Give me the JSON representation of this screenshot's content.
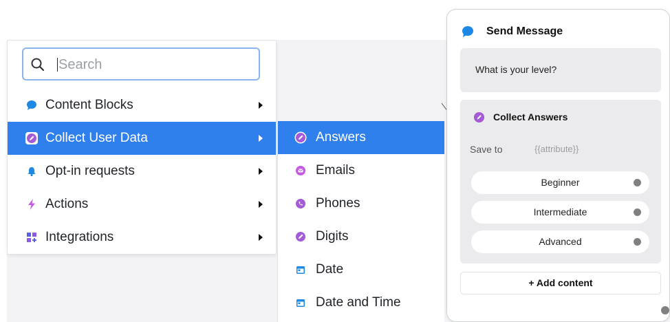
{
  "search": {
    "placeholder": "Search"
  },
  "menu": {
    "items": [
      {
        "label": "Content Blocks",
        "icon": "chat-bubble-icon"
      },
      {
        "label": "Collect User Data",
        "icon": "edit-circle-icon",
        "active": true
      },
      {
        "label": "Opt-in requests",
        "icon": "bell-icon"
      },
      {
        "label": "Actions",
        "icon": "lightning-icon"
      },
      {
        "label": "Integrations",
        "icon": "grid-plus-icon"
      }
    ]
  },
  "submenu": {
    "items": [
      {
        "label": "Answers",
        "icon": "edit-circle-icon",
        "active": true
      },
      {
        "label": "Emails",
        "icon": "email-icon"
      },
      {
        "label": "Phones",
        "icon": "phone-icon"
      },
      {
        "label": "Digits",
        "icon": "edit-circle-icon"
      },
      {
        "label": "Date",
        "icon": "calendar-icon"
      },
      {
        "label": "Date and Time",
        "icon": "calendar-icon"
      }
    ]
  },
  "node": {
    "title": "Send Message",
    "message": "What is your level?",
    "collect_title": "Collect Answers",
    "save_to_label": "Save to",
    "save_to_value": "{{attribute}}",
    "answers": [
      "Beginner",
      "Intermediate",
      "Advanced"
    ],
    "add_content_label": "+ Add content"
  },
  "colors": {
    "accent": "#2f80ed",
    "purple": "#a45bd6",
    "chat_blue": "#1e88e5"
  }
}
